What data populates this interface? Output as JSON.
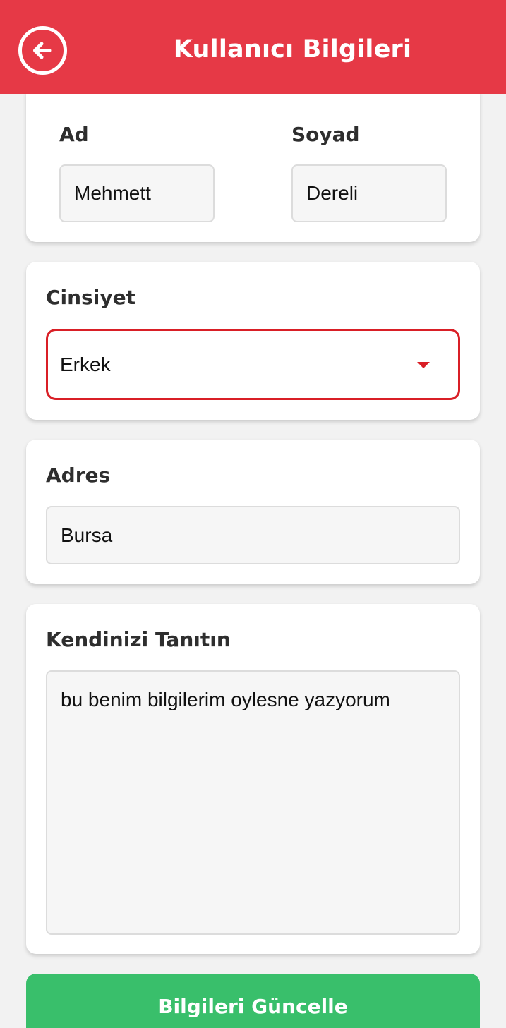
{
  "header": {
    "title": "Kullanıcı Bilgileri",
    "back_icon": "arrow-left-circle-icon",
    "color": "#e63946"
  },
  "name_card": {
    "first_name_label": "Ad",
    "first_name_value": "Mehmett",
    "last_name_label": "Soyad",
    "last_name_value": "Dereli"
  },
  "gender_card": {
    "label": "Cinsiyet",
    "selected": "Erkek",
    "dropdown_icon": "caret-down-icon"
  },
  "address_card": {
    "label": "Adres",
    "value": "Bursa"
  },
  "about_card": {
    "label": "Kendinizi Tanıtın",
    "value": "bu benim bilgilerim oylesne yazyorum"
  },
  "submit": {
    "label": "Bilgileri Güncelle",
    "color": "#39bf6b"
  }
}
